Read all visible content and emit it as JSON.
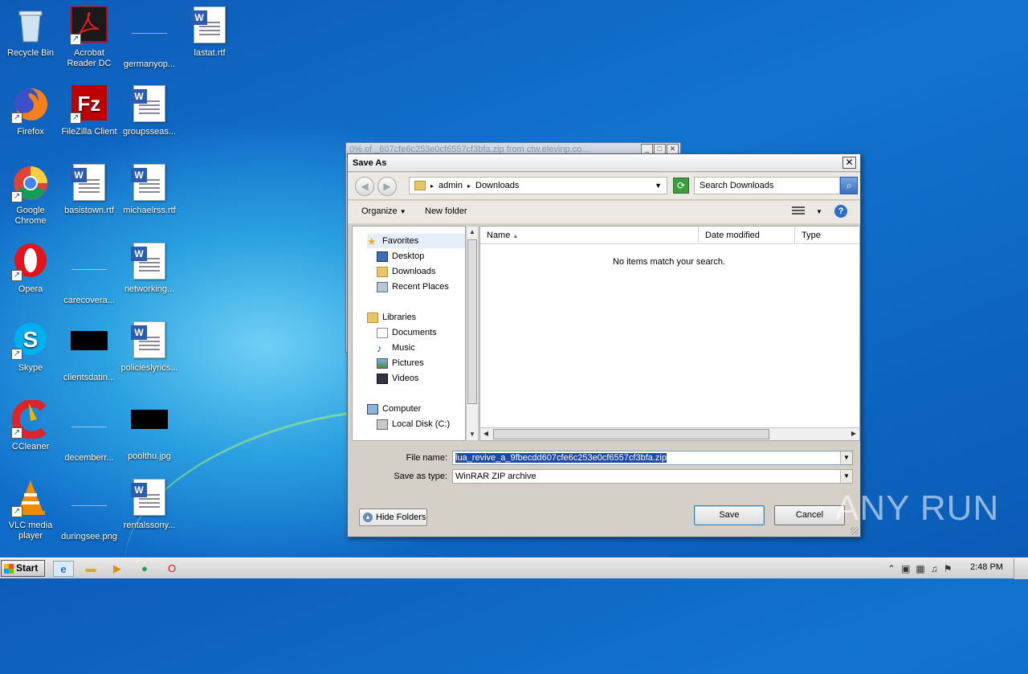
{
  "desktop": {
    "icons": [
      {
        "label": "Recycle Bin"
      },
      {
        "label": "Acrobat Reader DC"
      },
      {
        "label": "germanyop..."
      },
      {
        "label": "lastat.rtf"
      },
      {
        "label": "Firefox"
      },
      {
        "label": "FileZilla Client"
      },
      {
        "label": "groupsseas..."
      },
      {
        "label": "Google Chrome"
      },
      {
        "label": "basistown.rtf"
      },
      {
        "label": "michaelrss.rtf"
      },
      {
        "label": "Opera"
      },
      {
        "label": "carecovera..."
      },
      {
        "label": "networking..."
      },
      {
        "label": "Skype"
      },
      {
        "label": "clientsdatin..."
      },
      {
        "label": "policieslyrics..."
      },
      {
        "label": "CCleaner"
      },
      {
        "label": "decemberr..."
      },
      {
        "label": "poolthu.jpg"
      },
      {
        "label": "VLC media player"
      },
      {
        "label": "duringsee.png"
      },
      {
        "label": "rentalssony..."
      }
    ],
    "watermark": "ANY RUN"
  },
  "background_window": {
    "title": "0% of _607cfe6c253e0cf6557cf3bfa.zip from ctw.elevinp.co..."
  },
  "dialog": {
    "title": "Save As",
    "breadcrumb": [
      "admin",
      "Downloads"
    ],
    "search_placeholder": "Search Downloads",
    "toolbar": {
      "organize": "Organize",
      "new_folder": "New folder"
    },
    "nav": {
      "favorites": "Favorites",
      "desktop": "Desktop",
      "downloads": "Downloads",
      "recent": "Recent Places",
      "libraries": "Libraries",
      "documents": "Documents",
      "music": "Music",
      "pictures": "Pictures",
      "videos": "Videos",
      "computer": "Computer",
      "localdisk": "Local Disk (C:)"
    },
    "columns": [
      "Name",
      "Date modified",
      "Type"
    ],
    "empty_message": "No items match your search.",
    "file_name_label": "File name:",
    "file_name_value": "lua_revive_a_9fbecdd607cfe6c253e0cf6557cf3bfa.zip",
    "save_type_label": "Save as type:",
    "save_type_value": "WinRAR ZIP archive",
    "hide_folders": "Hide Folders",
    "save": "Save",
    "cancel": "Cancel"
  },
  "taskbar": {
    "start": "Start",
    "clock": "2:48 PM"
  }
}
